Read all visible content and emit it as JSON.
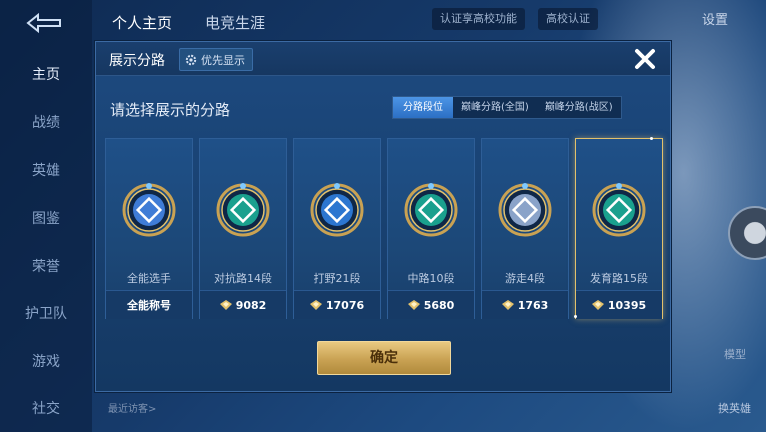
{
  "background": {
    "nav": [
      "主页",
      "战绩",
      "英雄",
      "图鉴",
      "荣誉",
      "护卫队",
      "游戏",
      "社交"
    ],
    "top_tabs": [
      "个人主页",
      "电竞生涯"
    ],
    "top_pills": [
      "认证享高校功能",
      "高校认证"
    ],
    "settings": "设置",
    "model_label": "模型",
    "swap_hero": "换英雄",
    "recent_visitors": "最近访客>"
  },
  "modal": {
    "title": "展示分路",
    "priority_label": "优先显示",
    "subtitle": "请选择展示的分路",
    "tabs": [
      "分路段位",
      "巅峰分路(全国)",
      "巅峰分路(战区)"
    ],
    "active_tab_index": 0,
    "cards": [
      {
        "name": "全能选手",
        "stat": "全能称号",
        "emblem_color": "#3f7cd6",
        "has_points_icon": false
      },
      {
        "name": "对抗路14段",
        "stat": "9082",
        "emblem_color": "#1aa08e",
        "has_points_icon": true
      },
      {
        "name": "打野21段",
        "stat": "17076",
        "emblem_color": "#2c76d0",
        "has_points_icon": true
      },
      {
        "name": "中路10段",
        "stat": "5680",
        "emblem_color": "#1aa08e",
        "has_points_icon": true
      },
      {
        "name": "游走4段",
        "stat": "1763",
        "emblem_color": "#8aa3c9",
        "has_points_icon": true
      },
      {
        "name": "发育路15段",
        "stat": "10395",
        "emblem_color": "#1aa08e",
        "has_points_icon": true
      }
    ],
    "selected_card_index": 5,
    "confirm_label": "确定"
  },
  "colors": {
    "gold": "#e2c16c",
    "modal_bg": "#1d4a80",
    "active_tab": "#2c6fc4"
  }
}
